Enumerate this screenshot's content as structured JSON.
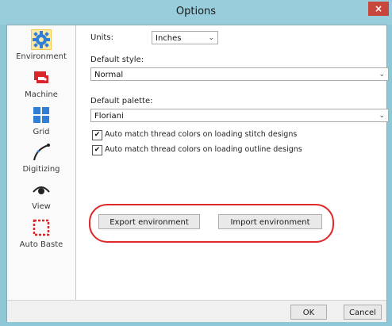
{
  "window": {
    "title": "Options",
    "close_glyph": "×"
  },
  "sidebar": {
    "items": [
      {
        "label": "Environment",
        "icon": "gear-icon"
      },
      {
        "label": "Machine",
        "icon": "sewing-machine-icon"
      },
      {
        "label": "Grid",
        "icon": "grid-icon"
      },
      {
        "label": "Digitizing",
        "icon": "curve-icon"
      },
      {
        "label": "View",
        "icon": "eye-icon"
      },
      {
        "label": "Auto Baste",
        "icon": "dotted-square-icon"
      }
    ]
  },
  "panel": {
    "units_label": "Units:",
    "units_value": "Inches",
    "default_style_label": "Default style:",
    "default_style_value": "Normal",
    "default_palette_label": "Default palette:",
    "default_palette_value": "Floriani",
    "checkbox_stitch": "Auto match thread colors on loading stitch designs",
    "checkbox_outline": "Auto match thread colors on loading outline designs",
    "check_glyph": "✔",
    "chevron": "⌄",
    "export_button": "Export environment",
    "import_button": "Import environment"
  },
  "footer": {
    "ok_button": "OK",
    "cancel_button": "Cancel"
  },
  "colors": {
    "titlebar": "#98cddb",
    "highlight": "#e0292b",
    "close": "#c8473c"
  }
}
